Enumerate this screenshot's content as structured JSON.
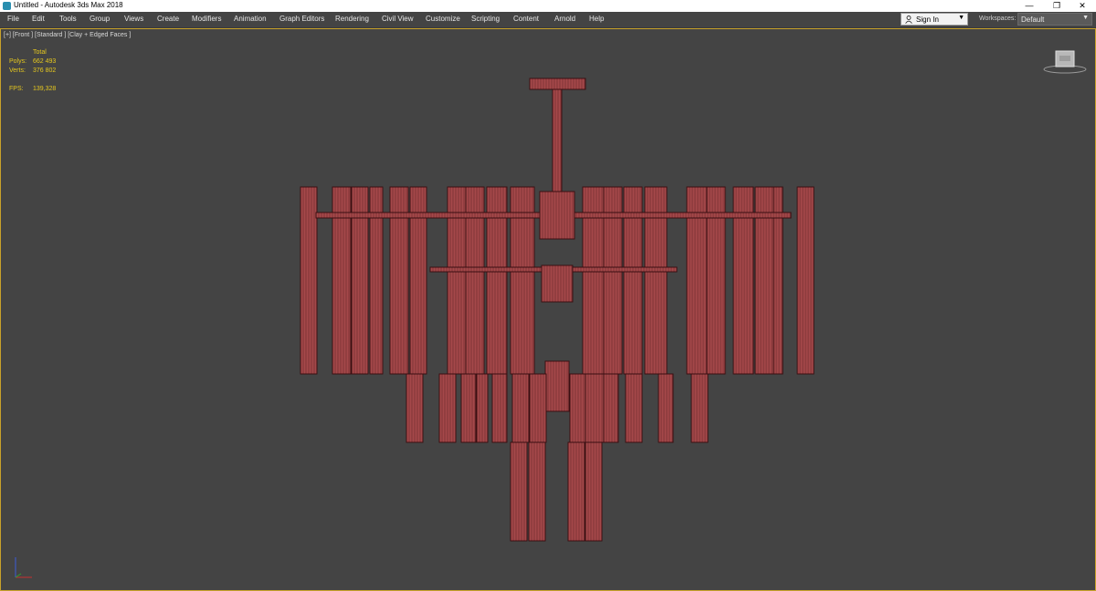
{
  "window": {
    "title": "Untitled - Autodesk 3ds Max 2018",
    "controls": {
      "minimize": "—",
      "restore": "❐",
      "close": "✕"
    }
  },
  "menu": {
    "items": [
      "File",
      "Edit",
      "Tools",
      "Group",
      "Views",
      "Create",
      "Modifiers",
      "Animation",
      "Graph Editors",
      "Rendering",
      "Civil View",
      "Customize",
      "Scripting",
      "Content",
      "Arnold",
      "Help"
    ]
  },
  "account": {
    "sign_in_label": "Sign In",
    "caret": "▼"
  },
  "workspaces": {
    "label": "Workspaces:",
    "value": "Default",
    "caret": "▼"
  },
  "viewport": {
    "label": "[+] [Front ] [Standard ] [Clay + Edged Faces ]",
    "stats": {
      "total_label": "Total",
      "polys_label": "Polys:",
      "polys_value": "662 493",
      "verts_label": "Verts:",
      "verts_value": "376 802",
      "fps_label": "FPS:",
      "fps_value": "139,328"
    },
    "viewcube_icon": "viewcube-icon",
    "axis_icon": "axis-tripod-icon"
  },
  "colors": {
    "viewport_bg": "#444444",
    "active_border": "#c8a22a",
    "stats_text": "#e6c81e",
    "model_fill": "#a5484a",
    "model_wire": "#3a0f12"
  }
}
